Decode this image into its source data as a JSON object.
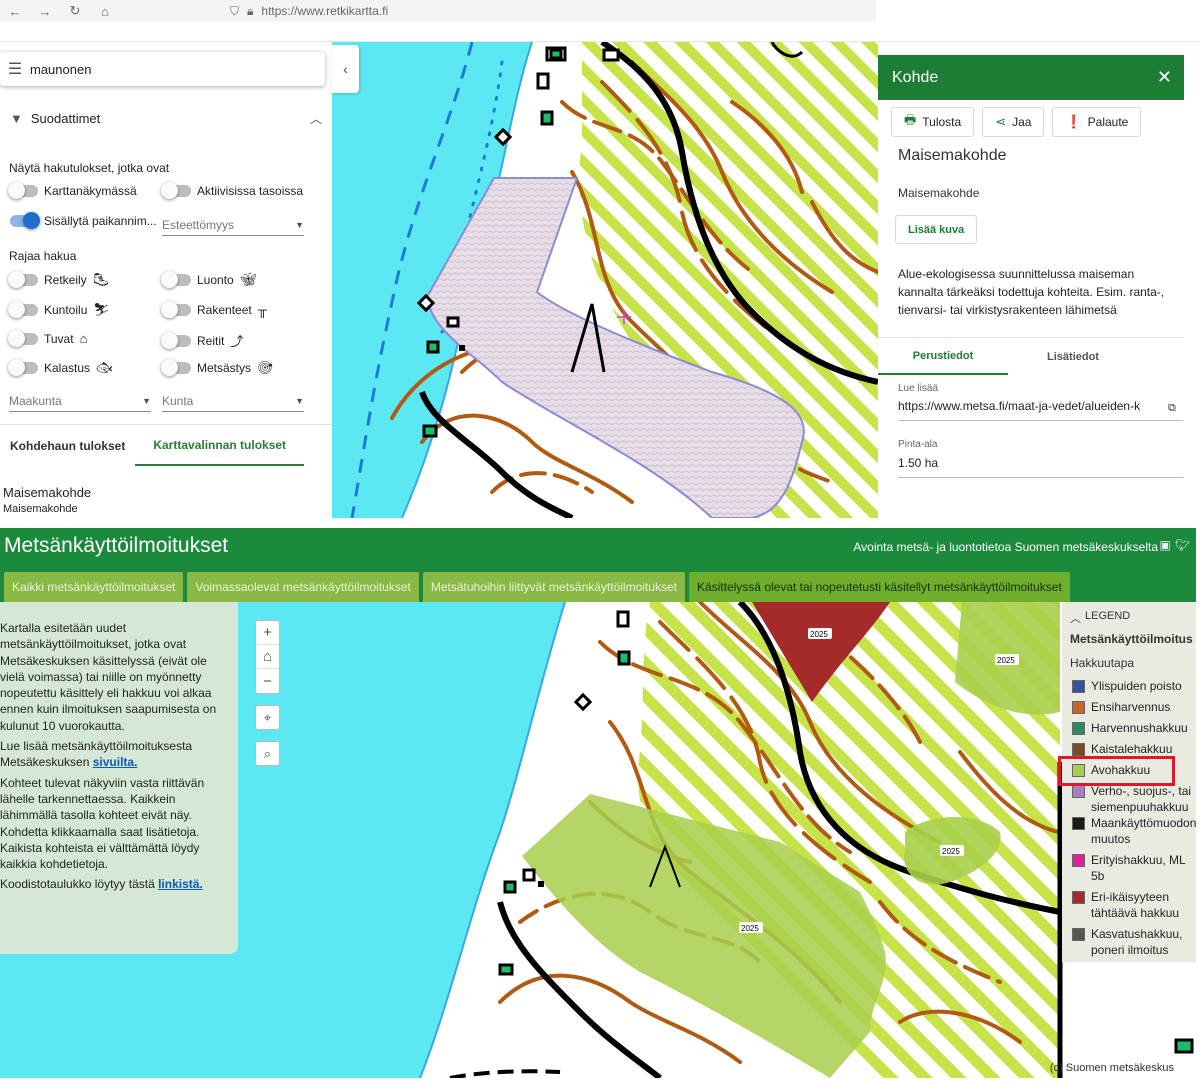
{
  "browser": {
    "url": "https://www.retkikartta.fi"
  },
  "left_panel": {
    "search_value": "maunonen",
    "filters_label": "Suodattimet",
    "show_results_label": "Näytä hakutulokset, jotka ovat",
    "toggles": [
      {
        "label": "Karttanäkymässä",
        "on": false
      },
      {
        "label": "Aktiivisissa tasoissa",
        "on": false
      },
      {
        "label": "Sisällytä paikannim...",
        "on": true
      }
    ],
    "accessibility_placeholder": "Esteettömyys",
    "restrict_label": "Rajaa hakua",
    "categories": [
      {
        "label": "Retkeily",
        "icon": "hiker-icon"
      },
      {
        "label": "Luonto",
        "icon": "butterfly-icon"
      },
      {
        "label": "Kuntoilu",
        "icon": "skier-icon"
      },
      {
        "label": "Rakenteet",
        "icon": "picnic-table-icon"
      },
      {
        "label": "Tuvat",
        "icon": "house-icon"
      },
      {
        "label": "Reitit",
        "icon": "route-icon"
      },
      {
        "label": "Kalastus",
        "icon": "fish-icon"
      },
      {
        "label": "Metsästys",
        "icon": "hunter-icon"
      }
    ],
    "region_placeholder": "Maakunta",
    "municipality_placeholder": "Kunta",
    "tabs": [
      "Kohdehaun tulokset",
      "Karttavalinnan tulokset"
    ],
    "result_title": "Maisemakohde",
    "result_subtitle": "Maisemakohde"
  },
  "info_panel": {
    "header": "Kohde",
    "buttons": {
      "print": "Tulosta",
      "share": "Jaa",
      "feedback": "Palaute"
    },
    "title": "Maisemakohde",
    "type": "Maisemakohde",
    "add_image": "Lisää kuva",
    "description": "Alue-ekologisessa suunnittelussa maiseman kannalta tärkeäksi todettuja kohteita. Esim. ranta-, tienvarsi- tai virkistysrakenteen lähimetsä",
    "tabs": [
      "Perustiedot",
      "Lisätiedot"
    ],
    "more_label": "Lue lisää",
    "more_value": "https://www.metsa.fi/maat-ja-vedet/alueiden-k",
    "area_label": "Pinta-ala",
    "area_value": "1.50 ha"
  },
  "app2": {
    "title": "Metsänkäyttöilmoitukset",
    "subtitle": "Avointa metsä- ja luontotietoa Suomen metsäkeskukselta",
    "tabs": [
      "Kaikki metsänkäyttöilmoitukset",
      "Voimassaolevat metsänkäyttöilmoitukset",
      "Metsätuhoihin liittyvät metsänkäyttöilmoitukset",
      "Käsittelyssä olevat tai nopeutetusti käsitellyt metsänkäyttöilmoitukset"
    ],
    "info": {
      "p1": "Kartalla esitetään uudet metsänkäyttöilmoitukset, jotka ovat Metsäkeskuksen käsittelyssä (eivät ole vielä voimassa) tai niille on myönnetty nopeutettu käsittely eli hakkuu voi alkaa ennen kuin ilmoituksen saapumisesta on kulunut 10 vuorokautta.",
      "p2_pre": "Lue lisää metsänkäyttöilmoituksesta Metsäkeskuksen ",
      "p2_link": "sivuilta.",
      "p3": "Kohteet tulevat näkyviin vasta riittävän lähelle tarkennettaessa. Kaikkein lähimmällä tasolla kohteet eivät näy. Kohdetta klikkaamalla saat lisätietoja. Kaikista kohteista ei välttämättä löydy kaikkia kohdetietoja.",
      "p4_pre": "Koodistotaulukko löytyy tästä ",
      "p4_link": "linkistä."
    },
    "feature_labels": [
      "2025",
      "2025",
      "2025",
      "2025"
    ],
    "legend": {
      "head": "LEGEND",
      "title": "Metsänkäyttöilmoitus",
      "subtitle": "Hakkuutapa",
      "items": [
        {
          "label": "Ylispuiden poisto",
          "color": "#3b4fa0"
        },
        {
          "label": "Ensiharvennus",
          "color": "#c8642d"
        },
        {
          "label": "Harvennushakkuu",
          "color": "#2e8a5e"
        },
        {
          "label": "Kaistalehakkuu",
          "color": "#7a4a25"
        },
        {
          "label": "Avohakkuu",
          "color": "#a8cf4b"
        },
        {
          "label": "Verho-, suojus-, tai siemenpuuhakkuu",
          "color": "#a97fbf"
        },
        {
          "label": "Maankäyttömuodon muutos",
          "color": "#1a1a1a"
        },
        {
          "label": "Erityishakkuu, ML 5b",
          "color": "#e0219c"
        },
        {
          "label": "Eri-ikäisyyteen tähtäävä hakkuu",
          "color": "#a52a2a"
        },
        {
          "label": "Kasvatushakkuu, poneri ilmoitus",
          "color": "#555555"
        }
      ]
    },
    "copyright": "(c) Suomen metsäkeskus"
  },
  "colors": {
    "green_header": "#1c8a3c",
    "water": "#5ce8f2",
    "hatch": "#c6e34a",
    "contour": "#b15a12"
  }
}
